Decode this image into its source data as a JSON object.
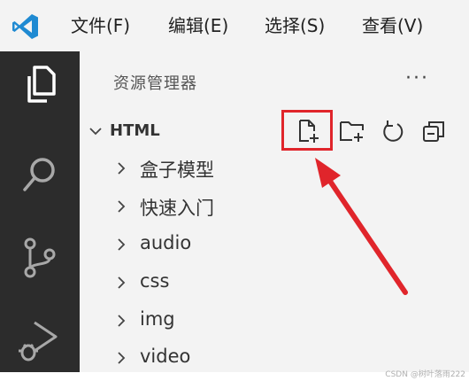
{
  "menu": {
    "items": [
      "文件(F)",
      "编辑(E)",
      "选择(S)",
      "查看(V)"
    ]
  },
  "activity_bar": {
    "icons": [
      "explorer-icon",
      "search-icon",
      "source-control-icon",
      "run-debug-icon"
    ]
  },
  "explorer": {
    "title": "资源管理器",
    "more": "···",
    "section": {
      "label": "HTML",
      "expanded": true,
      "toolbar": [
        "new-file-icon",
        "new-folder-icon",
        "refresh-icon",
        "collapse-all-icon"
      ],
      "highlighted_action": "new-file-icon"
    },
    "items": [
      {
        "label": "盒子模型"
      },
      {
        "label": "快速入门"
      },
      {
        "label": "audio"
      },
      {
        "label": "css"
      },
      {
        "label": "img"
      },
      {
        "label": "video"
      }
    ]
  },
  "annotation": {
    "color": "#e0252b"
  },
  "watermark": "CSDN @树叶落雨222",
  "colors": {
    "activity_bar": "#2c2c2c",
    "sidebar": "#f3f3f3",
    "vscode_blue": "#1f8ad2"
  }
}
